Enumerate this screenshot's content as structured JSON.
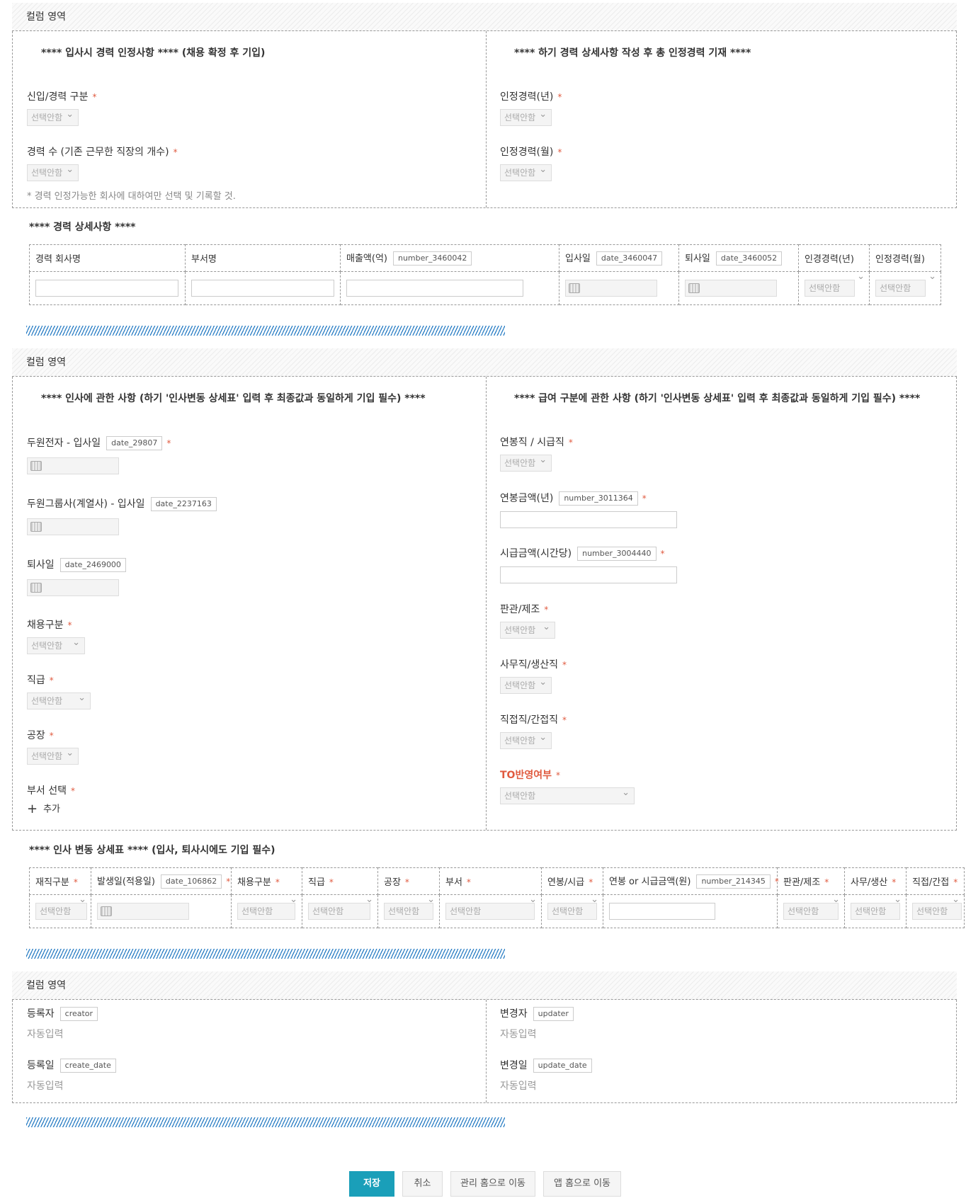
{
  "section1": {
    "header": "컬럼 영역",
    "left_notice": "**** 입사시 경력 인정사항 ****  (채용 확정 후 기입)",
    "right_notice": "**** 하기 경력 상세사항 작성 후 총 인정경력 기재 ****",
    "fields": {
      "newcareer": "신입/경력 구분",
      "careercount": "경력 수 (기존 근무한 직장의 개수)",
      "careernote": "* 경력 인정가능한 회사에 대하여만 선택 및 기록할 것.",
      "recog_year": "인정경력(년)",
      "recog_month": "인정경력(월)"
    },
    "select_placeholder": "선택안함",
    "star": "*"
  },
  "career_detail": {
    "title": "**** 경력 상세사항 ****",
    "columns": {
      "company": "경력 회사명",
      "dept": "부서명",
      "sales": "매출액(억)",
      "sales_tag": "number_3460042",
      "join": "입사일",
      "join_tag": "date_3460047",
      "leave": "퇴사일",
      "leave_tag": "date_3460052",
      "ryear": "인경경력(년)",
      "rmonth": "인정경력(월)"
    }
  },
  "section2": {
    "header": "컬럼 영역",
    "left_notice": "**** 인사에 관한 사항 (하기 '인사변동 상세표' 입력 후 최종값과 동일하게 기입 필수) ****",
    "right_notice": "**** 급여 구분에 관한 사항 (하기 '인사변동 상세표' 입력 후 최종값과 동일하게 기입 필수) ****",
    "left": {
      "doowon_join": "두원전자 - 입사일",
      "doowon_join_tag": "date_29807",
      "group_join": "두원그룹사(계열사) - 입사일",
      "group_join_tag": "date_2237163",
      "leave": "퇴사일",
      "leave_tag": "date_2469000",
      "hire_type": "채용구분",
      "rank": "직급",
      "factory": "공장",
      "dept_select": "부서 선택",
      "add": "추가"
    },
    "right": {
      "salary_type": "연봉직 / 시급직",
      "annual": "연봉금액(년)",
      "annual_tag": "number_3011364",
      "hourly": "시급금액(시간당)",
      "hourly_tag": "number_3004440",
      "sales_mfg": "판관/제조",
      "office_prod": "사무직/생산직",
      "direct": "직접직/간접직",
      "to_reflect": "TO반영여부"
    }
  },
  "hr_change": {
    "title": "**** 인사 변동 상세표 **** (입사, 퇴사시에도 기입 필수)",
    "columns": {
      "status": "재직구분",
      "date": "발생일(적용일)",
      "date_tag": "date_106862",
      "hire": "채용구분",
      "rank": "직급",
      "factory": "공장",
      "dept": "부서",
      "salary": "연봉/시급",
      "amount": "연봉 or 시급금액(원)",
      "amount_tag": "number_214345",
      "salesmfg": "판관/제조",
      "officeprod": "사무/생산",
      "direct": "직접/간접"
    }
  },
  "section3": {
    "header": "컬럼 영역",
    "creator": "등록자",
    "creator_tag": "creator",
    "create_date": "등록일",
    "create_date_tag": "create_date",
    "updater": "변경자",
    "updater_tag": "updater",
    "update_date": "변경일",
    "update_date_tag": "update_date",
    "auto": "자동입력"
  },
  "buttons": {
    "save": "저장",
    "cancel": "취소",
    "admin_home": "관리 홈으로 이동",
    "app_home": "앱 홈으로 이동"
  },
  "colors": {
    "accent": "#1a9fb9",
    "notice": "#e05a3f",
    "stripe": "#2c7fc5"
  }
}
